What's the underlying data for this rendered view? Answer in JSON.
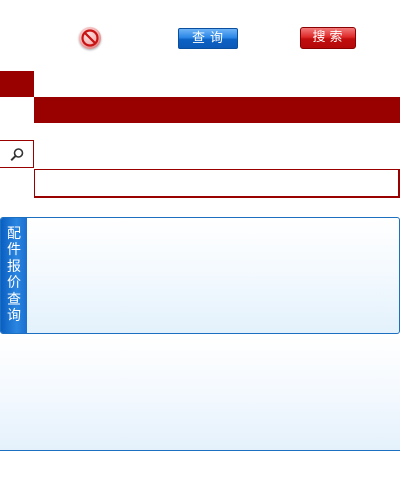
{
  "toolbar": {
    "no_icon": "no-entry-icon",
    "query_label": "查询",
    "search_label": "搜索"
  },
  "search": {
    "icon": "magnifier-icon",
    "value": "",
    "placeholder": ""
  },
  "panel": {
    "tab_label": "配件报价查询"
  },
  "colors": {
    "header_red": "#990000",
    "query_blue": "#1a73d6",
    "search_red": "#cc1111",
    "panel_border": "#1d6fbf"
  }
}
